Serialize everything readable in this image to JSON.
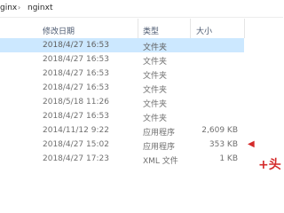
{
  "breadcrumb": {
    "items": [
      "ginx",
      "nginxt"
    ],
    "separator": "›"
  },
  "columns": [
    "修改日期",
    "类型",
    "大小"
  ],
  "rows": [
    {
      "date": "2018/4/27 16:53",
      "type": "文件夹",
      "size": "",
      "selected": true
    },
    {
      "date": "2018/4/27 16:53",
      "type": "文件夹",
      "size": ""
    },
    {
      "date": "2018/4/27 16:53",
      "type": "文件夹",
      "size": ""
    },
    {
      "date": "2018/4/27 16:53",
      "type": "文件夹",
      "size": ""
    },
    {
      "date": "2018/5/18 11:26",
      "type": "文件夹",
      "size": ""
    },
    {
      "date": "2018/4/27 16:53",
      "type": "文件夹",
      "size": ""
    },
    {
      "date": "2014/11/12 9:22",
      "type": "应用程序",
      "size": "2,609 KB"
    },
    {
      "date": "2018/4/27 15:02",
      "type": "应用程序",
      "size": "353 KB"
    },
    {
      "date": "2018/4/27 17:23",
      "type": "XML 文件",
      "size": "1 KB"
    }
  ],
  "annotations": {
    "arrow_glyph": "◀",
    "marker_text": "+头"
  },
  "colors": {
    "selection": "#cce8ff",
    "annotation": "#d42a2a"
  }
}
